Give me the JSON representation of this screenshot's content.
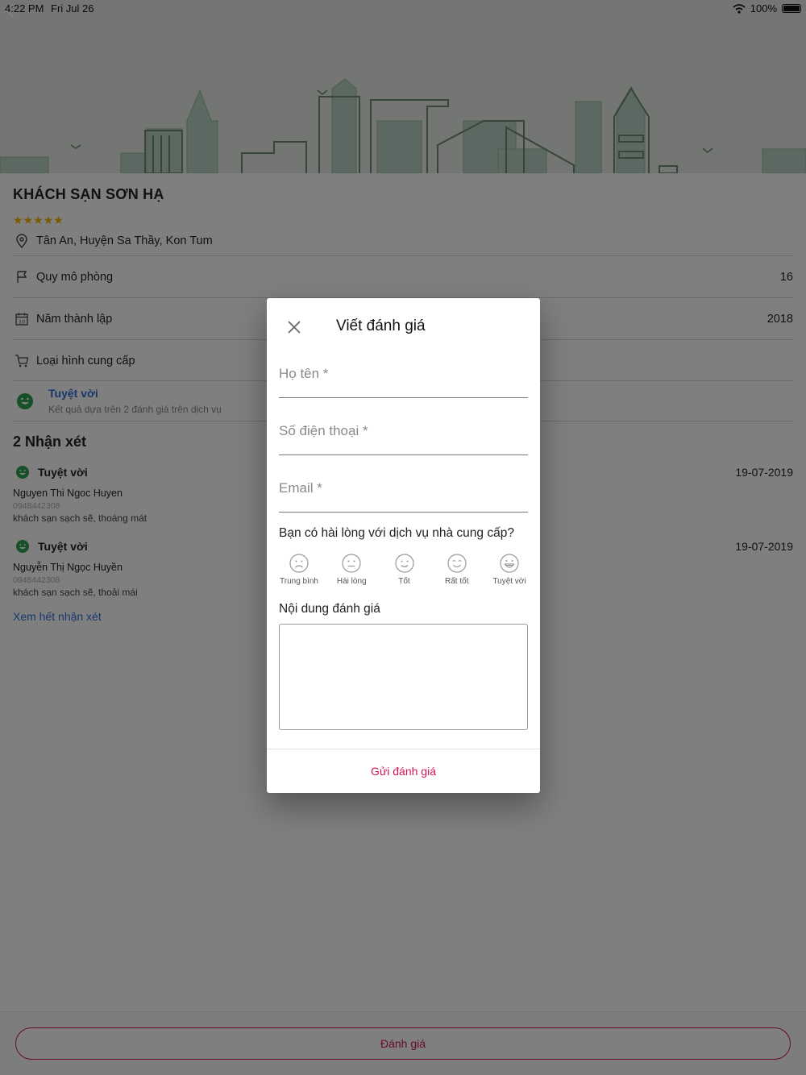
{
  "status_bar": {
    "time": "4:22 PM",
    "date": "Fri Jul 26",
    "battery": "100%"
  },
  "hotel": {
    "name": "KHÁCH SẠN SƠN HẠ",
    "stars": "★★★★★",
    "address": "Tân An, Huyện Sa Thầy, Kon Tum",
    "info": [
      {
        "label": "Quy mô phòng",
        "value": "16",
        "icon": "flag-icon"
      },
      {
        "label": "Năm thành lập",
        "value": "2018",
        "icon": "calendar-icon"
      },
      {
        "label": "Loại hình cung cấp",
        "value": "",
        "icon": "cart-icon"
      }
    ],
    "rating": {
      "label": "Tuyệt vời",
      "sub": "Kết quả dựa trên 2 đánh giá trên dịch vụ"
    }
  },
  "reviews": {
    "title": "2 Nhận xét",
    "items": [
      {
        "rating": "Tuyệt vời",
        "date": "19-07-2019",
        "name": "Nguyen Thi Ngoc Huyen",
        "phone": "0948442308",
        "comment": "khách sạn sạch sẽ, thoáng mát"
      },
      {
        "rating": "Tuyệt vời",
        "date": "19-07-2019",
        "name": "Nguyễn Thị Ngọc Huyền",
        "phone": "0948442308",
        "comment": "khách sạn sạch sẽ, thoải mái"
      }
    ],
    "see_all": "Xem hết nhận xét"
  },
  "bottom": {
    "review_button": "Đánh giá"
  },
  "modal": {
    "title": "Viết đánh giá",
    "name_placeholder": "Họ tên *",
    "phone_placeholder": "Số điện thoại *",
    "email_placeholder": "Email *",
    "satisfaction_question": "Bạn có hài lòng với dịch vụ nhà cung cấp?",
    "options": [
      "Trung bình",
      "Hài lòng",
      "Tốt",
      "Rất tốt",
      "Tuyệt vời"
    ],
    "content_label": "Nội dung đánh giá",
    "content_value": "",
    "submit": "Gửi đánh giá"
  },
  "colors": {
    "accent": "#d3145a",
    "link": "#2f6fd6",
    "star": "#f5b400",
    "good": "#2e9e4f"
  }
}
